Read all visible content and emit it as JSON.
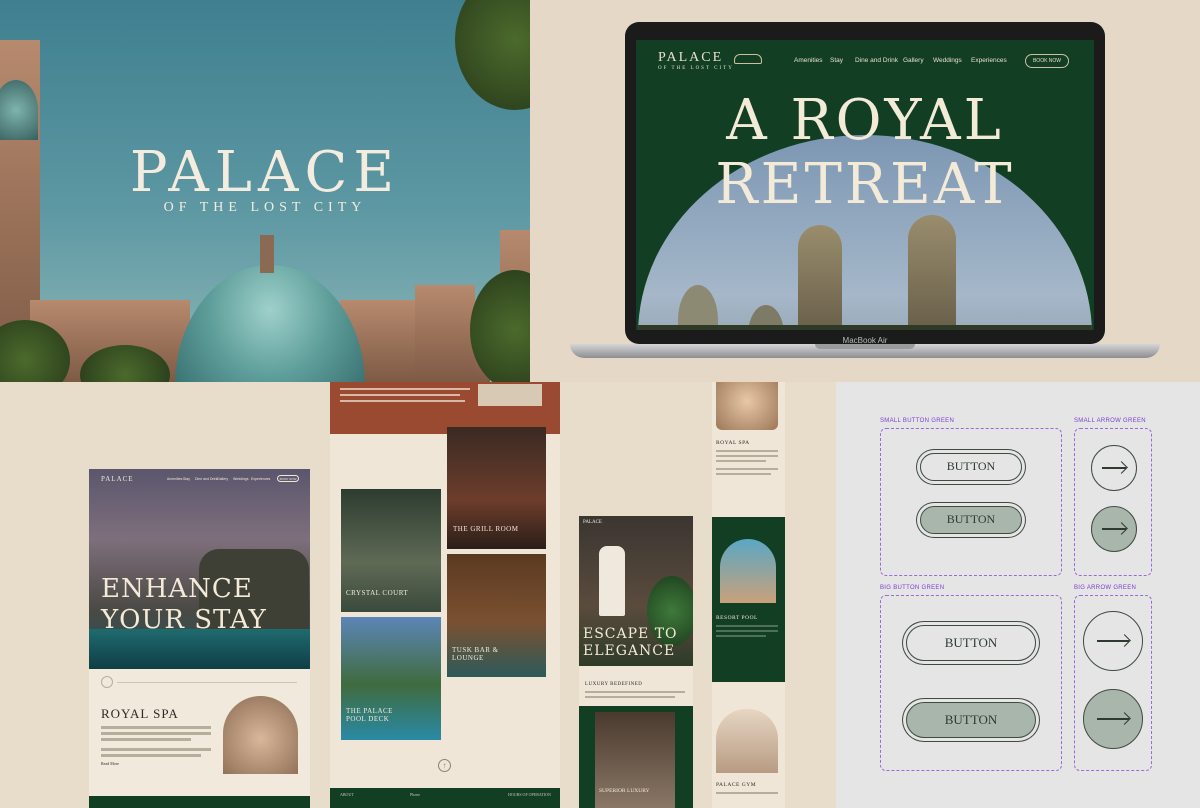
{
  "hero": {
    "title": "PALACE",
    "subtitle": "OF THE LOST CITY"
  },
  "laptop": {
    "model": "MacBook Air",
    "logo": "PALACE",
    "logo_sub": "OF THE LOST CITY",
    "nav": [
      "Amenities",
      "Stay",
      "Dine and Drink",
      "Gallery",
      "Weddings",
      "Experiences"
    ],
    "book_label": "BOOK NOW",
    "headline_1": "A ROYAL",
    "headline_2": "RETREAT"
  },
  "enhance_page": {
    "logo": "PALACE",
    "nav": [
      "Amenities",
      "Stay",
      "Dine and Drink",
      "Gallery",
      "Weddings",
      "Experiences"
    ],
    "book_label": "BOOK NOW",
    "headline_1": "ENHANCE",
    "headline_2": "YOUR STAY",
    "section_title": "ROYAL SPA",
    "read_more": "Read More"
  },
  "dine_page": {
    "captions": [
      "THE GRILL ROOM",
      "CRYSTAL COURT",
      "TUSK BAR & LOUNGE",
      "THE PALACE POOL DECK"
    ],
    "footer": [
      "ABOUT",
      "Phone",
      "HOURS OF OPERATION"
    ]
  },
  "escape_page": {
    "logo": "PALACE",
    "headline_1": "ESCAPE TO",
    "headline_2": "ELEGANCE",
    "section": "LUXURY REDEFINED",
    "room_caption": "SUPERIOR LUXURY"
  },
  "strip_page": {
    "spa": "ROYAL SPA",
    "pool": "RESORT POOL",
    "gym": "PALACE GYM"
  },
  "components": {
    "small_button_label": "SMALL BUTTON GREEN",
    "small_arrow_label": "SMALL ARROW GREEN",
    "big_button_label": "BIG BUTTON GREEN",
    "big_arrow_label": "BIG ARROW GREEN",
    "button_text": "BUTTON",
    "colors": {
      "green": "#123f24",
      "sage": "#a9b6ab",
      "outline": "#3f4a41",
      "purple": "#7a3fd0"
    }
  }
}
